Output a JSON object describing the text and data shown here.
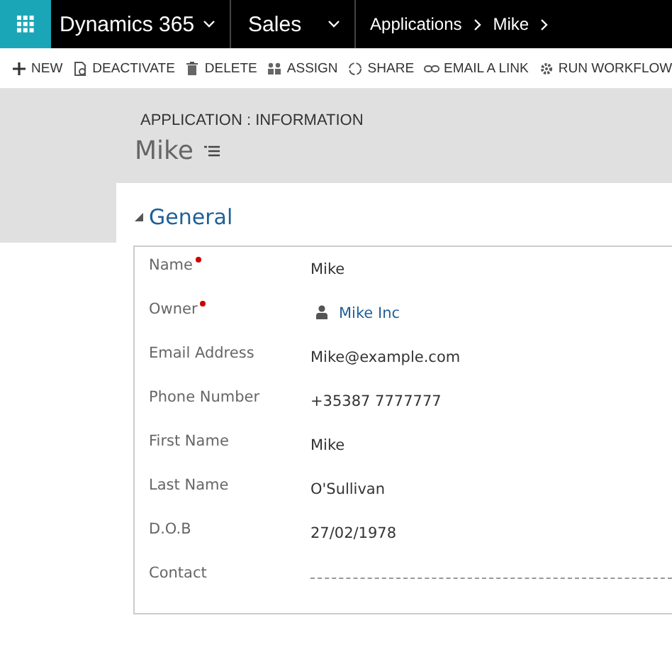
{
  "top_bar": {
    "app_name": "Dynamics 365",
    "area": "Sales",
    "breadcrumbs": [
      "Applications",
      "Mike"
    ]
  },
  "commands": [
    {
      "label": "NEW"
    },
    {
      "label": "DEACTIVATE"
    },
    {
      "label": "DELETE"
    },
    {
      "label": "ASSIGN"
    },
    {
      "label": "SHARE"
    },
    {
      "label": "EMAIL A LINK"
    },
    {
      "label": "RUN WORKFLOW"
    }
  ],
  "header": {
    "form_label": "APPLICATION : INFORMATION",
    "record_name": "Mike"
  },
  "section": {
    "title": "General",
    "expanded": true,
    "fields": [
      {
        "label": "Name",
        "required": true,
        "kind": "text",
        "value": "Mike"
      },
      {
        "label": "Owner",
        "required": true,
        "kind": "lookup",
        "value": "Mike Inc"
      },
      {
        "label": "Email Address",
        "required": false,
        "kind": "text",
        "value": "Mike@example.com"
      },
      {
        "label": "Phone Number",
        "required": false,
        "kind": "text",
        "value": "+35387 7777777"
      },
      {
        "label": "First Name",
        "required": false,
        "kind": "text",
        "value": "Mike"
      },
      {
        "label": "Last Name",
        "required": false,
        "kind": "text",
        "value": "O'Sullivan"
      },
      {
        "label": "D.O.B",
        "required": false,
        "kind": "text",
        "value": "27/02/1978"
      },
      {
        "label": "Contact",
        "required": false,
        "kind": "empty"
      }
    ]
  }
}
